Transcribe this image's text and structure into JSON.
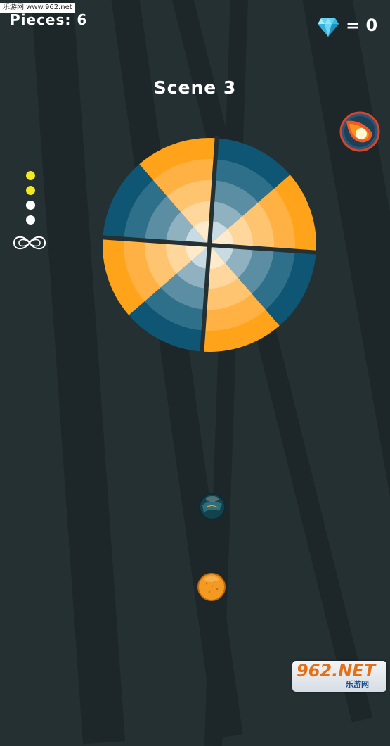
{
  "watermark": {
    "text": "乐游网 www.962.net"
  },
  "hud": {
    "pieces_label": "Pieces: 6",
    "gems_label": "= 0"
  },
  "scene": {
    "title": "Scene 3"
  },
  "progress_dots": {
    "filled_count": 2,
    "total": 4,
    "filled_color": "#f2ea1b",
    "empty_color": "#ffffff"
  },
  "icons": {
    "gem": "diamond-icon",
    "infinity": "infinity-loop-icon",
    "powerup": "fireball-icon"
  },
  "colors": {
    "orange": "#ffa31a",
    "teal": "#0f5574",
    "background": "#253033"
  },
  "logo": {
    "main": "962.NET",
    "sub": "乐游网"
  }
}
